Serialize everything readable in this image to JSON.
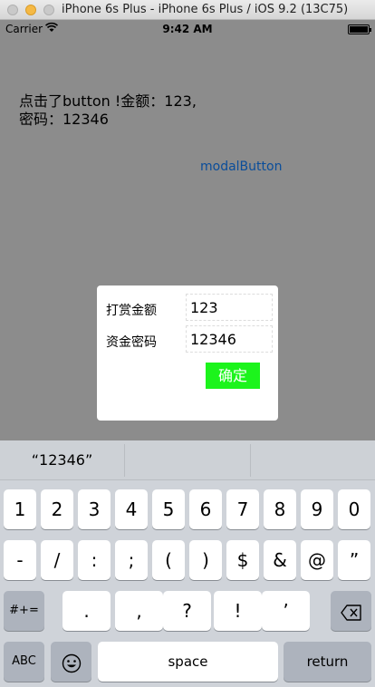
{
  "window": {
    "title": "iPhone 6s Plus - iPhone 6s Plus / iOS 9.2 (13C75)"
  },
  "statusbar": {
    "carrier": "Carrier",
    "time": "9:42 AM"
  },
  "main": {
    "message_line1": "点击了button !金额：123,",
    "message_line2": "密码：12346",
    "modal_button": "modalButton"
  },
  "dialog": {
    "amount_label": "打赏金额",
    "amount_value": "123",
    "password_label": "资金密码",
    "password_value": "12346",
    "confirm_label": "确定",
    "confirm_color": "#1cf41c"
  },
  "keyboard": {
    "suggestions": [
      "“12346”",
      "",
      ""
    ],
    "row1": [
      "1",
      "2",
      "3",
      "4",
      "5",
      "6",
      "7",
      "8",
      "9",
      "0"
    ],
    "row2": [
      "-",
      "/",
      ":",
      ";",
      "(",
      ")",
      "$",
      "&",
      "@",
      "”"
    ],
    "row3_left": "#+=",
    "row3": [
      ".",
      ",",
      "?",
      "!",
      "’"
    ],
    "abc": "ABC",
    "space": "space",
    "return": "return",
    "icons": {
      "backspace": "backspace-icon",
      "emoji": "emoji-icon"
    }
  }
}
